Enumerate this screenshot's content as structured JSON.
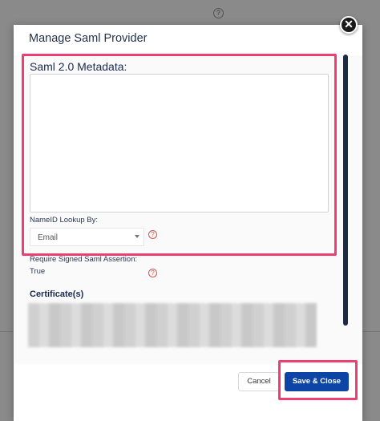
{
  "modal": {
    "title": "Manage Saml Provider",
    "close_icon": "close-icon"
  },
  "form": {
    "metadata_label": "Saml 2.0 Metadata:",
    "metadata_value": "",
    "nameid_label": "NameID Lookup By:",
    "nameid_selected": "Email",
    "help_icon": "question-circle-icon",
    "signed_assertion_label": "Require Signed Saml Assertion:",
    "signed_assertion_value": "True",
    "certificate_label": "Certificate(s)"
  },
  "footer": {
    "cancel_label": "Cancel",
    "save_label": "Save & Close"
  },
  "colors": {
    "highlight": "#ee3e72",
    "primary_button": "#0c45a6",
    "help_icon": "#d9534f"
  }
}
